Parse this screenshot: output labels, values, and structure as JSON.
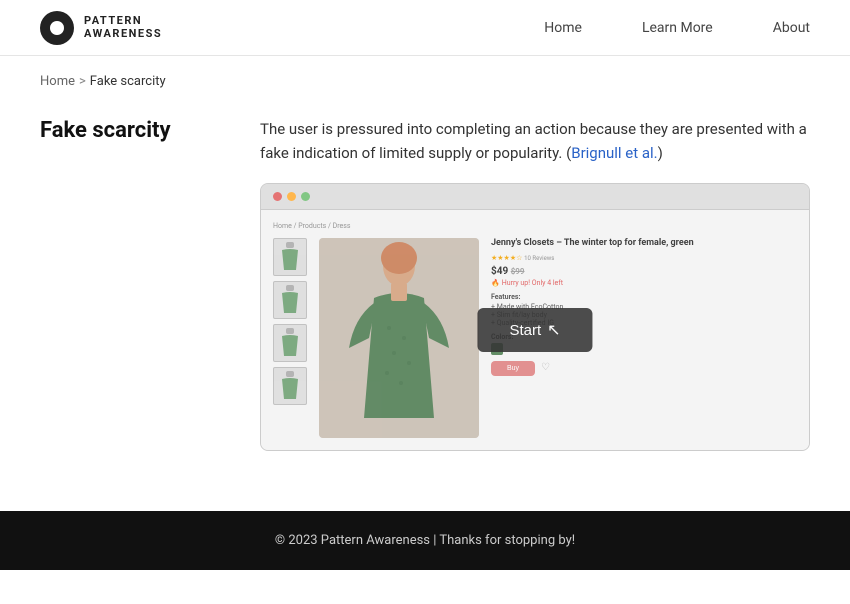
{
  "header": {
    "logo_line1": "PATTERN",
    "logo_line2": "AWARENESS",
    "nav": {
      "home": "Home",
      "learn_more": "Learn More",
      "about": "About"
    }
  },
  "breadcrumb": {
    "home": "Home",
    "separator": ">",
    "current": "Fake scarcity"
  },
  "page": {
    "title": "Fake scarcity",
    "description": "The user is pressured into completing an action because they are presented with a fake indication of limited supply or popularity.",
    "citation_text": "Brignull et al.",
    "citation_suffix": ")"
  },
  "demo": {
    "breadcrumb": "Home / Products / Dress",
    "product_title": "Jenny's Closets – The winter top for female, green",
    "stars": "★★★★☆",
    "review_count": "10 Reviews",
    "price": "$49",
    "price_old": "$99",
    "hurry_text": "Hurry up! Only  4 left",
    "features_label": "Features:",
    "features": [
      "Made with EcoCotton",
      "Slim fit/lay body",
      "Quality-certified IG"
    ],
    "colors_label": "Colors:",
    "buy_label": "Buy",
    "start_label": "Start"
  },
  "footer": {
    "text": "© 2023 Pattern Awareness | Thanks for stopping by!"
  }
}
